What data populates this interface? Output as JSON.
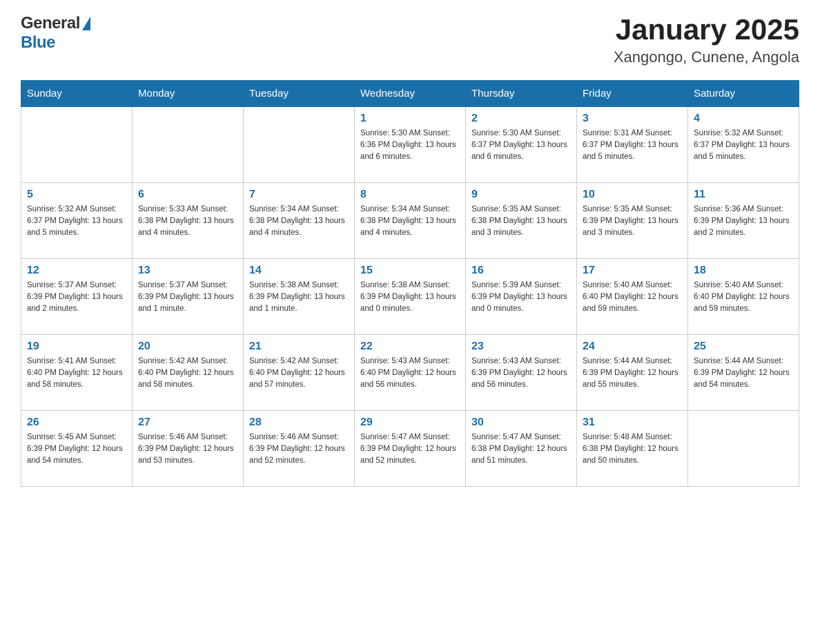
{
  "header": {
    "logo_general": "General",
    "logo_blue": "Blue",
    "title": "January 2025",
    "subtitle": "Xangongo, Cunene, Angola"
  },
  "calendar": {
    "days_of_week": [
      "Sunday",
      "Monday",
      "Tuesday",
      "Wednesday",
      "Thursday",
      "Friday",
      "Saturday"
    ],
    "weeks": [
      [
        {
          "day": "",
          "info": ""
        },
        {
          "day": "",
          "info": ""
        },
        {
          "day": "",
          "info": ""
        },
        {
          "day": "1",
          "info": "Sunrise: 5:30 AM\nSunset: 6:36 PM\nDaylight: 13 hours and 6 minutes."
        },
        {
          "day": "2",
          "info": "Sunrise: 5:30 AM\nSunset: 6:37 PM\nDaylight: 13 hours and 6 minutes."
        },
        {
          "day": "3",
          "info": "Sunrise: 5:31 AM\nSunset: 6:37 PM\nDaylight: 13 hours and 5 minutes."
        },
        {
          "day": "4",
          "info": "Sunrise: 5:32 AM\nSunset: 6:37 PM\nDaylight: 13 hours and 5 minutes."
        }
      ],
      [
        {
          "day": "5",
          "info": "Sunrise: 5:32 AM\nSunset: 6:37 PM\nDaylight: 13 hours and 5 minutes."
        },
        {
          "day": "6",
          "info": "Sunrise: 5:33 AM\nSunset: 6:38 PM\nDaylight: 13 hours and 4 minutes."
        },
        {
          "day": "7",
          "info": "Sunrise: 5:34 AM\nSunset: 6:38 PM\nDaylight: 13 hours and 4 minutes."
        },
        {
          "day": "8",
          "info": "Sunrise: 5:34 AM\nSunset: 6:38 PM\nDaylight: 13 hours and 4 minutes."
        },
        {
          "day": "9",
          "info": "Sunrise: 5:35 AM\nSunset: 6:38 PM\nDaylight: 13 hours and 3 minutes."
        },
        {
          "day": "10",
          "info": "Sunrise: 5:35 AM\nSunset: 6:39 PM\nDaylight: 13 hours and 3 minutes."
        },
        {
          "day": "11",
          "info": "Sunrise: 5:36 AM\nSunset: 6:39 PM\nDaylight: 13 hours and 2 minutes."
        }
      ],
      [
        {
          "day": "12",
          "info": "Sunrise: 5:37 AM\nSunset: 6:39 PM\nDaylight: 13 hours and 2 minutes."
        },
        {
          "day": "13",
          "info": "Sunrise: 5:37 AM\nSunset: 6:39 PM\nDaylight: 13 hours and 1 minute."
        },
        {
          "day": "14",
          "info": "Sunrise: 5:38 AM\nSunset: 6:39 PM\nDaylight: 13 hours and 1 minute."
        },
        {
          "day": "15",
          "info": "Sunrise: 5:38 AM\nSunset: 6:39 PM\nDaylight: 13 hours and 0 minutes."
        },
        {
          "day": "16",
          "info": "Sunrise: 5:39 AM\nSunset: 6:39 PM\nDaylight: 13 hours and 0 minutes."
        },
        {
          "day": "17",
          "info": "Sunrise: 5:40 AM\nSunset: 6:40 PM\nDaylight: 12 hours and 59 minutes."
        },
        {
          "day": "18",
          "info": "Sunrise: 5:40 AM\nSunset: 6:40 PM\nDaylight: 12 hours and 59 minutes."
        }
      ],
      [
        {
          "day": "19",
          "info": "Sunrise: 5:41 AM\nSunset: 6:40 PM\nDaylight: 12 hours and 58 minutes."
        },
        {
          "day": "20",
          "info": "Sunrise: 5:42 AM\nSunset: 6:40 PM\nDaylight: 12 hours and 58 minutes."
        },
        {
          "day": "21",
          "info": "Sunrise: 5:42 AM\nSunset: 6:40 PM\nDaylight: 12 hours and 57 minutes."
        },
        {
          "day": "22",
          "info": "Sunrise: 5:43 AM\nSunset: 6:40 PM\nDaylight: 12 hours and 56 minutes."
        },
        {
          "day": "23",
          "info": "Sunrise: 5:43 AM\nSunset: 6:39 PM\nDaylight: 12 hours and 56 minutes."
        },
        {
          "day": "24",
          "info": "Sunrise: 5:44 AM\nSunset: 6:39 PM\nDaylight: 12 hours and 55 minutes."
        },
        {
          "day": "25",
          "info": "Sunrise: 5:44 AM\nSunset: 6:39 PM\nDaylight: 12 hours and 54 minutes."
        }
      ],
      [
        {
          "day": "26",
          "info": "Sunrise: 5:45 AM\nSunset: 6:39 PM\nDaylight: 12 hours and 54 minutes."
        },
        {
          "day": "27",
          "info": "Sunrise: 5:46 AM\nSunset: 6:39 PM\nDaylight: 12 hours and 53 minutes."
        },
        {
          "day": "28",
          "info": "Sunrise: 5:46 AM\nSunset: 6:39 PM\nDaylight: 12 hours and 52 minutes."
        },
        {
          "day": "29",
          "info": "Sunrise: 5:47 AM\nSunset: 6:39 PM\nDaylight: 12 hours and 52 minutes."
        },
        {
          "day": "30",
          "info": "Sunrise: 5:47 AM\nSunset: 6:38 PM\nDaylight: 12 hours and 51 minutes."
        },
        {
          "day": "31",
          "info": "Sunrise: 5:48 AM\nSunset: 6:38 PM\nDaylight: 12 hours and 50 minutes."
        },
        {
          "day": "",
          "info": ""
        }
      ]
    ]
  }
}
